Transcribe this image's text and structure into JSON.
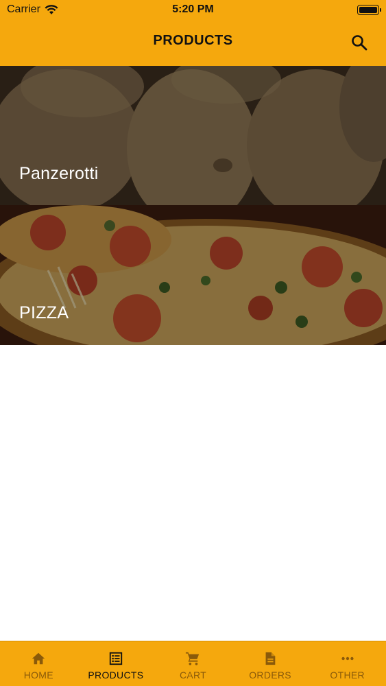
{
  "status_bar": {
    "carrier": "Carrier",
    "time": "5:20 PM"
  },
  "header": {
    "title": "PRODUCTS",
    "search_icon": "search-icon"
  },
  "categories": [
    {
      "label": "Panzerotti"
    },
    {
      "label": "PIZZA"
    }
  ],
  "tabs": [
    {
      "label": "HOME",
      "icon": "home-icon",
      "active": false
    },
    {
      "label": "PRODUCTS",
      "icon": "list-icon",
      "active": true
    },
    {
      "label": "CART",
      "icon": "cart-icon",
      "active": false
    },
    {
      "label": "ORDERS",
      "icon": "document-icon",
      "active": false
    },
    {
      "label": "OTHER",
      "icon": "more-icon",
      "active": false
    }
  ],
  "colors": {
    "accent": "#F5A80D",
    "active_tab": "#111111",
    "inactive_tab": "#8A5A0A"
  }
}
